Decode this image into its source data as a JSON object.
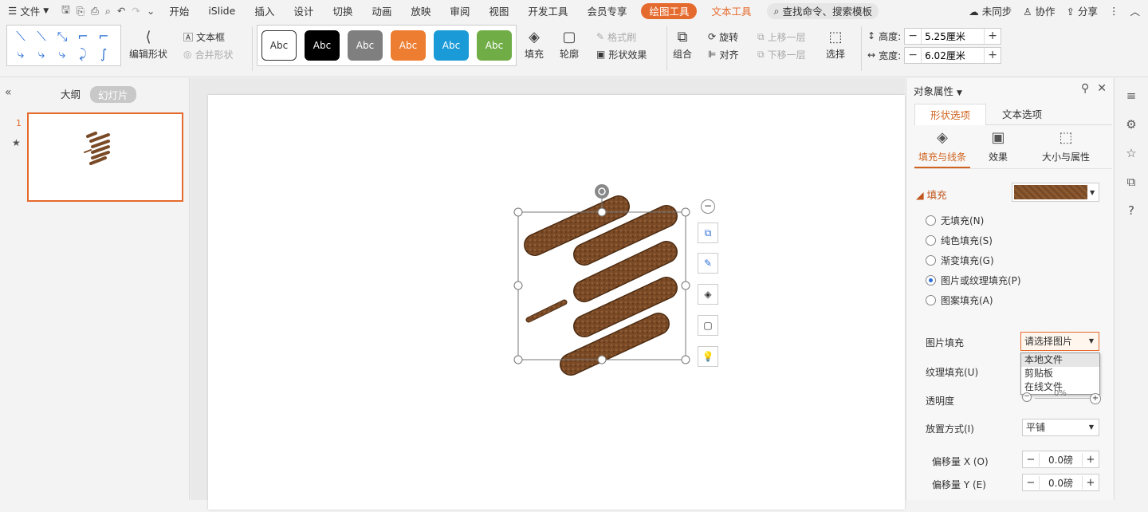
{
  "menu": {
    "file_label": "文件"
  },
  "tabs": [
    "开始",
    "iSlide",
    "插入",
    "设计",
    "切换",
    "动画",
    "放映",
    "审阅",
    "视图",
    "开发工具",
    "会员专享"
  ],
  "active_tab": "绘图工具",
  "extra_tab": "文本工具",
  "search_placeholder": "查找命令、搜索模板",
  "top_right": {
    "sync": "未同步",
    "collab": "协作",
    "share": "分享"
  },
  "ribbon": {
    "edit_shape": "编辑形状",
    "textbox": "文本框",
    "merge_shape": "合并形状",
    "style_labels": [
      "Abc",
      "Abc",
      "Abc",
      "Abc",
      "Abc",
      "Abc"
    ],
    "fill": "填充",
    "outline": "轮廓",
    "format_painter": "格式刷",
    "shape_effect": "形状效果",
    "group": "组合",
    "rotate": "旋转",
    "align": "对齐",
    "bring_forward": "上移一层",
    "send_backward": "下移一层",
    "select": "选择",
    "height_label": "高度:",
    "height_value": "5.25厘米",
    "width_label": "宽度:",
    "width_value": "6.02厘米"
  },
  "left_panel": {
    "outline_tab": "大纲",
    "slides_tab": "幻灯片",
    "slide_number": "1"
  },
  "right_panel": {
    "title": "对象属性",
    "tab_shape": "形状选项",
    "tab_text": "文本选项",
    "sub_fill": "填充与线条",
    "sub_effect": "效果",
    "sub_size": "大小与属性",
    "section_fill": "填充",
    "radio_none": "无填充(N)",
    "radio_solid": "纯色填充(S)",
    "radio_gradient": "渐变填充(G)",
    "radio_picture": "图片或纹理填充(P)",
    "radio_pattern": "图案填充(A)",
    "picture_fill_label": "图片填充",
    "picture_fill_value": "请选择图片",
    "dropdown_items": [
      "本地文件",
      "剪贴板",
      "在线文件"
    ],
    "texture_label": "纹理填充(U)",
    "transparency_label": "透明度",
    "transparency_value": "0%",
    "tile_label": "放置方式(I)",
    "tile_value": "平铺",
    "offset_x_label": "偏移量 X (O)",
    "offset_x_value": "0.0磅",
    "offset_y_label": "偏移量 Y (E)",
    "offset_y_value": "0.0磅"
  },
  "colors": {
    "accent": "#e56a2d",
    "leather": "#7a4a26",
    "style_black": "#000000",
    "style_gray": "#7f7f7f",
    "style_orange": "#ed7d31",
    "style_blue": "#1a9bd7",
    "style_green": "#70ad47"
  }
}
